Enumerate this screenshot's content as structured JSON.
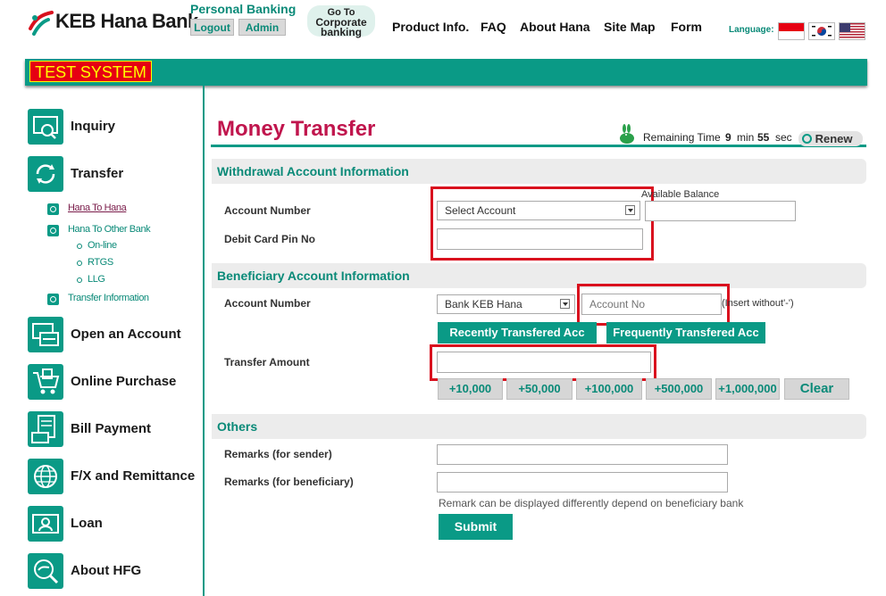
{
  "header": {
    "logo_text": "KEB Hana Bank",
    "personal_banking": "Personal Banking",
    "logout_label": "Logout",
    "admin_label": "Admin",
    "goto_line1": "Go To",
    "goto_line2": "Corporate",
    "goto_line3": "banking",
    "nav": [
      "Product Info.",
      "FAQ",
      "About Hana",
      "Site Map",
      "Form"
    ],
    "language_label": "Language:",
    "languages": [
      "indonesia-flag-icon",
      "korea-flag-icon",
      "usa-flag-icon"
    ]
  },
  "banner": {
    "test_system": "TEST SYSTEM"
  },
  "sidebar": {
    "items": [
      {
        "label": "Inquiry",
        "icon": "inquiry-icon"
      },
      {
        "label": "Transfer",
        "icon": "transfer-icon"
      },
      {
        "label": "Open an Account",
        "icon": "open-account-icon"
      },
      {
        "label": "Online Purchase",
        "icon": "online-purchase-icon"
      },
      {
        "label": "Bill Payment",
        "icon": "bill-payment-icon"
      },
      {
        "label": "F/X and Remittance",
        "icon": "globe-icon"
      },
      {
        "label": "Loan",
        "icon": "loan-icon"
      },
      {
        "label": "About HFG",
        "icon": "about-hfg-icon"
      }
    ],
    "transfer_sub": [
      "Hana To Hana",
      "Hana To Other Bank",
      "Transfer Information"
    ],
    "other_bank_sub": [
      "On-line",
      "RTGS",
      "LLG"
    ]
  },
  "main": {
    "title": "Money Transfer",
    "remaining_label": "Remaining Time",
    "minutes": "9",
    "min_label": "min",
    "seconds": "55",
    "sec_label": "sec",
    "renew_label": "Renew",
    "withdrawal": {
      "section_title": "Withdrawal Account Information",
      "account_number_label": "Account Number",
      "account_select": "Select Account",
      "available_balance_label": "Available Balance",
      "pin_label": "Debit Card Pin No"
    },
    "beneficiary": {
      "section_title": "Beneficiary Account Information",
      "account_number_label": "Account Number",
      "bank_select": "Bank KEB Hana",
      "account_placeholder": "Account No",
      "insert_hint": "(Insert without'-')",
      "recent_btn": "Recently Transfered Acc",
      "frequent_btn": "Frequently Transfered Acc",
      "amount_label": "Transfer Amount",
      "amount_buttons": [
        "+10,000",
        "+50,000",
        "+100,000",
        "+500,000",
        "+1,000,000"
      ],
      "clear_label": "Clear"
    },
    "others": {
      "section_title": "Others",
      "remarks_sender_label": "Remarks (for sender)",
      "remarks_beneficiary_label": "Remarks (for beneficiary)",
      "remark_note": "Remark can be displayed differently depend on beneficiary bank",
      "submit_label": "Submit"
    }
  },
  "colors": {
    "brand_teal": "#0a9a86",
    "title_red": "#c0154d",
    "highlight_red": "#d9101e"
  }
}
